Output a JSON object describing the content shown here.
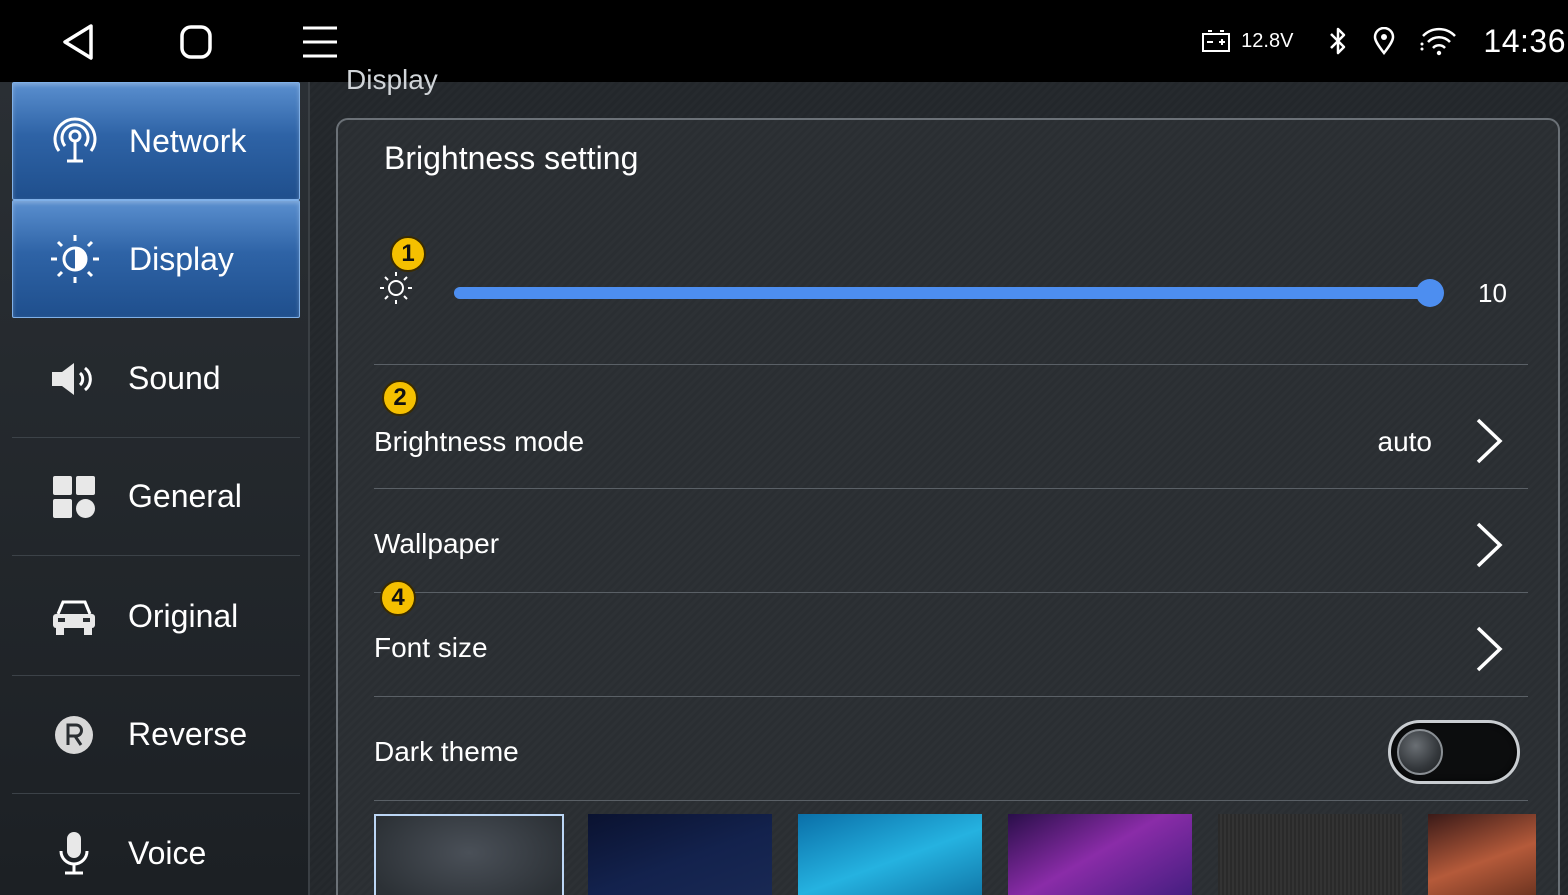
{
  "statusbar": {
    "voltage": "12.8V",
    "time": "14:36"
  },
  "sidebar": {
    "items": [
      {
        "label": "Network",
        "icon": "network-antenna-icon"
      },
      {
        "label": "Display",
        "icon": "sun-icon"
      },
      {
        "label": "Sound",
        "icon": "speaker-icon"
      },
      {
        "label": "General",
        "icon": "grid-icon"
      },
      {
        "label": "Original",
        "icon": "car-icon"
      },
      {
        "label": "Reverse",
        "icon": "reverse-r-icon"
      },
      {
        "label": "Voice",
        "icon": "microphone-icon"
      }
    ],
    "active_index": 1
  },
  "main": {
    "section_title": "Display",
    "card_title": "Brightness setting",
    "brightness": {
      "value": "10",
      "level_fraction": 1.0
    },
    "rows": {
      "brightness_mode": {
        "label": "Brightness mode",
        "value": "auto"
      },
      "wallpaper": {
        "label": "Wallpaper"
      },
      "font_size": {
        "label": "Font size"
      },
      "dark_theme": {
        "label": "Dark theme",
        "enabled": false
      }
    },
    "badges": [
      "1",
      "2",
      "4"
    ]
  },
  "colors": {
    "accent": "#4d8ef0",
    "active_sidebar": "#2e63a6",
    "badge": "#f5c000"
  }
}
